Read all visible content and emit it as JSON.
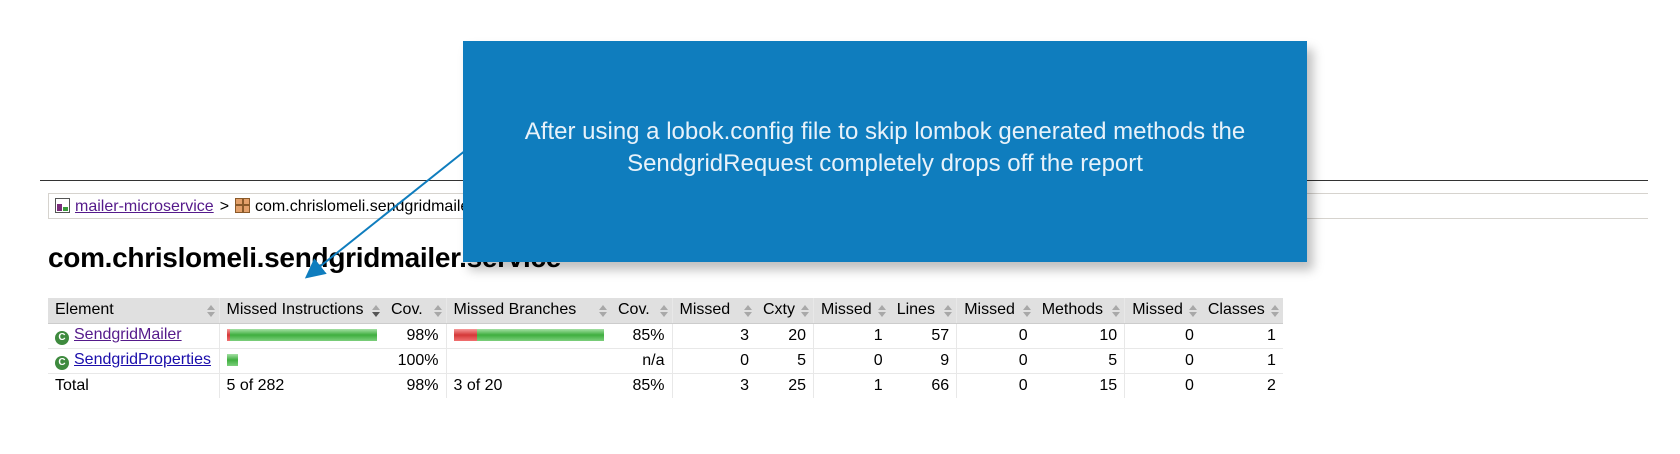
{
  "breadcrumb": {
    "project_link": "mailer-microservice",
    "separator": ">",
    "package_label": "com.chrislomeli.sendgridmailer.service"
  },
  "page_title": "com.chrislomeli.sendgridmailer.service",
  "table": {
    "headers": [
      "Element",
      "Missed Instructions",
      "Cov.",
      "Missed Branches",
      "Cov.",
      "Missed",
      "Cxty",
      "Missed",
      "Lines",
      "Missed",
      "Methods",
      "Missed",
      "Classes"
    ],
    "rows": [
      {
        "name": "SendgridMailer",
        "icon": "class-icon",
        "instr_missed_fraction": 0.018,
        "instr_bar_scale": 1.0,
        "instr_cov": "98%",
        "branch_missed_fraction": 0.15,
        "branch_bar_scale": 1.0,
        "branch_cov": "85%",
        "cxty_missed": "3",
        "cxty": "20",
        "lines_missed": "1",
        "lines": "57",
        "methods_missed": "0",
        "methods": "10",
        "classes_missed": "0",
        "classes": "1"
      },
      {
        "name": "SendgridProperties",
        "icon": "class-icon",
        "instr_missed_fraction": 0.0,
        "instr_bar_scale": 0.07,
        "instr_cov": "100%",
        "branch_missed_fraction": 0.0,
        "branch_bar_scale": 0.0,
        "branch_cov": "n/a",
        "cxty_missed": "0",
        "cxty": "5",
        "lines_missed": "0",
        "lines": "9",
        "methods_missed": "0",
        "methods": "5",
        "classes_missed": "0",
        "classes": "1"
      }
    ],
    "total": {
      "label": "Total",
      "instr": "5 of 282",
      "instr_cov": "98%",
      "branch": "3 of 20",
      "branch_cov": "85%",
      "cxty_missed": "3",
      "cxty": "25",
      "lines_missed": "1",
      "lines": "66",
      "methods_missed": "0",
      "methods": "15",
      "classes_missed": "0",
      "classes": "2"
    }
  },
  "callout": {
    "text": "After using  a lobok.config file to skip lombok generated methods the SendgridRequest completely drops off the report"
  },
  "colors": {
    "callout_bg": "#0f7dbe",
    "bar_missed": "#d43838",
    "bar_covered": "#3fae3f"
  }
}
